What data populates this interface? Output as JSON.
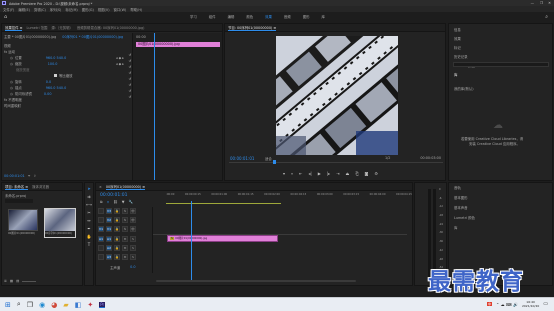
{
  "window": {
    "title": "Adobe Premiere Pro 2020 - D:\\视频\\未命名.prproj *",
    "controls": [
      "—",
      "❐",
      "✕"
    ]
  },
  "menu": [
    "文件(F)",
    "编辑(E)",
    "剪辑(C)",
    "序列(S)",
    "标记(M)",
    "图形(G)",
    "视图(V)",
    "窗口(W)",
    "帮助(H)"
  ],
  "workspaces": [
    "学习",
    "组件",
    "编辑",
    "颜色",
    "效果",
    "音频",
    "图形",
    "库"
  ],
  "workspace_active": "效果",
  "effect_controls": {
    "tabs": [
      "效果控件 ≡",
      "Lumetri 范围",
      "源:（无剪辑）",
      "音频剪辑混合器: 00序列01(00000000.jpg)"
    ],
    "source_label": "主要 * 00图片01(00000000).jpg",
    "seq_label": "00序列01 * 00图片01(00000000).jpg",
    "clip_name": "00图片01(00000000).jpg",
    "time": "00:00",
    "sections": {
      "video": "视频",
      "motion": "fx 运动",
      "position": "位置",
      "position_val": "960.0   540.0",
      "scale": "缩放",
      "scale_val": "100.0",
      "scale_w": "缩放宽度",
      "uniform": "等比缩放",
      "rotation": "旋转",
      "rotation_val": "0.0",
      "anchor": "锚点",
      "anchor_val": "960.0   540.0",
      "flicker": "防闪烁滤镜",
      "flicker_val": "0.00",
      "opacity": "fx 不透明度",
      "time_remap": "时间重映射"
    }
  },
  "program": {
    "tab": "节目: 00序列01(00000000) ≡",
    "timecode": "00:00:01:01",
    "fit": "适合",
    "scale": "1/2",
    "duration": "00:00:03:00"
  },
  "right_panel": {
    "items": [
      "信息",
      "效果",
      "标记",
      "历史记录",
      "Lumetri 颜色",
      "库"
    ],
    "search_label": "我的库",
    "library_dropdown": "我的库(默认)",
    "cloud_text_1": "若要使用 Creative Cloud Libraries，请",
    "cloud_text_2": "安装 Creative Cloud 应用程序。",
    "lower": [
      "音轨",
      "基本图形",
      "基本声音",
      "Lumetri 颜色",
      "库"
    ]
  },
  "project": {
    "tabs": [
      "项目: 未命名 ≡",
      "媒体浏览器"
    ],
    "path": "未命名.prproj",
    "search_placeholder": "",
    "items": [
      {
        "name": "00图片01(00000000)",
        "dur": "3:00"
      },
      {
        "name": "00序列01(00000000)",
        "dur": "3:00"
      }
    ]
  },
  "timeline": {
    "tab": "00序列01(00000000) ≡",
    "timecode": "00:00:01:01",
    "ruler": [
      ":00:00",
      "00:00:00:15",
      "00:00:01:00",
      "00:00:01:15",
      "00:00:02:00",
      "00:00:02:15",
      "00:00:03:00",
      "00:00:03:15",
      "00:00:04:00",
      "00:00:04:15"
    ],
    "tracks": [
      "V3",
      "V2",
      "V1",
      "A1",
      "A2",
      "A3",
      "主声道"
    ],
    "master_val": "0.0",
    "clip_label": "00图片01(00000000).jpg",
    "meter_labels": [
      "0",
      "-6",
      "-12",
      "-18",
      "-24",
      "-30",
      "-36",
      "-42",
      "-48",
      "-54",
      "dB"
    ]
  },
  "taskbar": {
    "clock_time": "16:40",
    "clock_date": "2021/10/20"
  },
  "watermark": "最需教育",
  "colors": {
    "accent": "#2d8ceb",
    "clip": "#e080d8",
    "bg": "#1d1d1d",
    "panel": "#232323"
  }
}
